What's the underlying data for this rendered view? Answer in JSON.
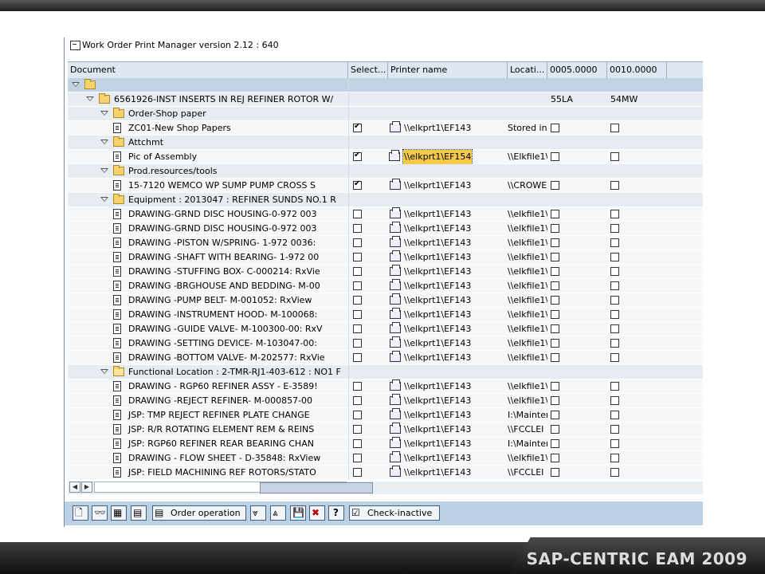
{
  "window": {
    "title": "Work Order Print Manager version 2.12 : 640"
  },
  "columns": [
    "Document",
    "Select...",
    "Printer name",
    "Locati...",
    "0005.0000",
    "0010.0000"
  ],
  "rows": [
    {
      "type": "root",
      "level": 0,
      "icon": "folder",
      "expanded": true
    },
    {
      "type": "node",
      "level": 1,
      "icon": "folder",
      "expanded": true,
      "label": "6561926-INST INSERTS IN REJ REFINER ROTOR W/",
      "c1": "55LA",
      "c2": "54MW"
    },
    {
      "type": "node",
      "level": 2,
      "icon": "folder",
      "expanded": true,
      "label": "Order-Shop paper"
    },
    {
      "type": "leaf",
      "level": 3,
      "icon": "doc",
      "label": "ZC01-New Shop Papers",
      "select": true,
      "printer": "\\\\elkprt1\\EF143",
      "location": "Stored in"
    },
    {
      "type": "node",
      "level": 2,
      "icon": "folder",
      "expanded": true,
      "label": "Attchmt"
    },
    {
      "type": "leaf",
      "level": 3,
      "icon": "doc",
      "label": "Pic of Assembly",
      "select": true,
      "printer": "\\\\elkprt1\\EF154",
      "location": "\\\\Elkfile1\\",
      "focus": true
    },
    {
      "type": "node",
      "level": 2,
      "icon": "folder",
      "expanded": true,
      "label": "Prod.resources/tools"
    },
    {
      "type": "leaf",
      "level": 3,
      "icon": "doc",
      "label": "15-7120 WEMCO WP SUMP PUMP CROSS S",
      "select": true,
      "printer": "\\\\elkprt1\\EF143",
      "location": "\\\\CROWE"
    },
    {
      "type": "node",
      "level": 2,
      "icon": "folder",
      "expanded": true,
      "label": "Equipment : 2013047 : REFINER SUNDS NO.1 R"
    },
    {
      "type": "leaf",
      "level": 3,
      "icon": "doc",
      "label": "DRAWING-GRND DISC HOUSING-0-972 003",
      "select": false,
      "printer": "\\\\elkprt1\\EF143",
      "location": "\\\\elkfile1\\"
    },
    {
      "type": "leaf",
      "level": 3,
      "icon": "doc",
      "label": "DRAWING-GRND DISC HOUSING-0-972 003",
      "select": false,
      "printer": "\\\\elkprt1\\EF143",
      "location": "\\\\elkfile1\\"
    },
    {
      "type": "leaf",
      "level": 3,
      "icon": "doc",
      "label": "DRAWING -PISTON W/SPRING- 1-972 0036:",
      "select": false,
      "printer": "\\\\elkprt1\\EF143",
      "location": "\\\\elkfile1\\"
    },
    {
      "type": "leaf",
      "level": 3,
      "icon": "doc",
      "label": "DRAWING -SHAFT WITH BEARING- 1-972 00",
      "select": false,
      "printer": "\\\\elkprt1\\EF143",
      "location": "\\\\elkfile1\\"
    },
    {
      "type": "leaf",
      "level": 3,
      "icon": "doc",
      "label": "DRAWING -STUFFING BOX- C-000214: RxVie",
      "select": false,
      "printer": "\\\\elkprt1\\EF143",
      "location": "\\\\elkfile1\\"
    },
    {
      "type": "leaf",
      "level": 3,
      "icon": "doc",
      "label": "DRAWING -BRGHOUSE AND BEDDING- M-00",
      "select": false,
      "printer": "\\\\elkprt1\\EF143",
      "location": "\\\\elkfile1\\"
    },
    {
      "type": "leaf",
      "level": 3,
      "icon": "doc",
      "label": "DRAWING -PUMP BELT- M-001052: RxView",
      "select": false,
      "printer": "\\\\elkprt1\\EF143",
      "location": "\\\\elkfile1\\"
    },
    {
      "type": "leaf",
      "level": 3,
      "icon": "doc",
      "label": "DRAWING -INSTRUMENT HOOD- M-100068:",
      "select": false,
      "printer": "\\\\elkprt1\\EF143",
      "location": "\\\\elkfile1\\"
    },
    {
      "type": "leaf",
      "level": 3,
      "icon": "doc",
      "label": "DRAWING -GUIDE VALVE- M-100300-00: RxV",
      "select": false,
      "printer": "\\\\elkprt1\\EF143",
      "location": "\\\\elkfile1\\"
    },
    {
      "type": "leaf",
      "level": 3,
      "icon": "doc",
      "label": "DRAWING -SETTING DEVICE- M-103047-00:",
      "select": false,
      "printer": "\\\\elkprt1\\EF143",
      "location": "\\\\elkfile1\\"
    },
    {
      "type": "leaf",
      "level": 3,
      "icon": "doc",
      "label": "DRAWING -BOTTOM VALVE- M-202577: RxVie",
      "select": false,
      "printer": "\\\\elkprt1\\EF143",
      "location": "\\\\elkfile1\\"
    },
    {
      "type": "node",
      "level": 2,
      "icon": "folder-open",
      "expanded": true,
      "label": "Functional Location : 2-TMR-RJ1-403-612 : NO1 F"
    },
    {
      "type": "leaf",
      "level": 3,
      "icon": "doc",
      "label": "DRAWING - RGP60 REFINER ASSY - E-3589!",
      "select": false,
      "printer": "\\\\elkprt1\\EF143",
      "location": "\\\\elkfile1\\"
    },
    {
      "type": "leaf",
      "level": 3,
      "icon": "doc",
      "label": "DRAWING -REJECT REFINER- M-000857-00",
      "select": false,
      "printer": "\\\\elkprt1\\EF143",
      "location": "\\\\elkfile1\\"
    },
    {
      "type": "leaf",
      "level": 3,
      "icon": "doc",
      "label": "JSP: TMP REJECT REFINER PLATE CHANGE",
      "select": false,
      "printer": "\\\\elkprt1\\EF143",
      "location": "I:\\Mainter"
    },
    {
      "type": "leaf",
      "level": 3,
      "icon": "doc",
      "label": "JSP: R/R ROTATING ELEMENT REM & REINS",
      "select": false,
      "printer": "\\\\elkprt1\\EF143",
      "location": "\\\\FCCLEI"
    },
    {
      "type": "leaf",
      "level": 3,
      "icon": "doc",
      "label": "JSP: RGP60 REFINER REAR BEARING CHAN",
      "select": false,
      "printer": "\\\\elkprt1\\EF143",
      "location": "I:\\Mainter"
    },
    {
      "type": "leaf",
      "level": 3,
      "icon": "doc",
      "label": "DRAWING - FLOW SHEET - D-35848: RxView",
      "select": false,
      "printer": "\\\\elkprt1\\EF143",
      "location": "\\\\elkfile1\\"
    },
    {
      "type": "leaf",
      "level": 3,
      "icon": "doc",
      "label": "JSP: FIELD MACHINING REF ROTORS/STATO",
      "select": false,
      "printer": "\\\\elkprt1\\EF143",
      "location": "\\\\FCCLEI"
    }
  ],
  "toolbar": {
    "buttons": [
      {
        "name": "page-icon",
        "glyph": "🗋"
      },
      {
        "name": "glasses-icon",
        "glyph": "👓"
      },
      {
        "name": "select-all-icon",
        "glyph": "▦"
      },
      {
        "name": "deselect-icon",
        "glyph": "▤"
      },
      {
        "name": "order-operation-button",
        "glyph": "▤",
        "label": "Order operation"
      },
      {
        "name": "expand-icon",
        "glyph": "⩔"
      },
      {
        "name": "collapse-icon",
        "glyph": "⩓"
      },
      {
        "name": "save-icon",
        "glyph": "💾"
      },
      {
        "name": "delete-icon",
        "glyph": "✖"
      },
      {
        "name": "help-icon",
        "glyph": "?"
      },
      {
        "name": "check-inactive-button",
        "glyph": "☑",
        "label": "Check-inactive"
      }
    ]
  },
  "footer": {
    "brand": "SAP-CENTRIC EAM 2009"
  },
  "colors": {
    "header_bg": "#dfe8f0",
    "node_bg": "#e6ecf2",
    "toolbar_bg": "#bcd0e6",
    "focus_highlight": "#f6c94b"
  }
}
